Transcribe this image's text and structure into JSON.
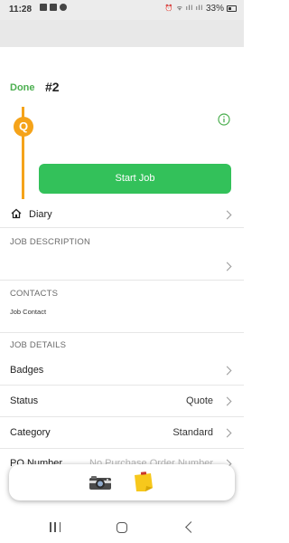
{
  "status_bar": {
    "time": "11:28",
    "battery": "33%"
  },
  "header": {
    "done_label": "Done",
    "title": "#2"
  },
  "job_status": {
    "badge_letter": "Q",
    "accent_color": "#f5a31a"
  },
  "start_job_label": "Start Job",
  "diary": {
    "label": "Diary",
    "icon": "home-icon"
  },
  "job_description": {
    "header": "JOB DESCRIPTION"
  },
  "contacts": {
    "header": "CONTACTS",
    "item": "Job Contact"
  },
  "job_details": {
    "header": "JOB DETAILS",
    "rows": [
      {
        "label": "Badges",
        "value": ""
      },
      {
        "label": "Status",
        "value": "Quote"
      },
      {
        "label": "Category",
        "value": "Standard"
      },
      {
        "label": "PO Number",
        "value": "No Purchase Order Number"
      }
    ]
  },
  "toolbar": {
    "camera_icon": "camera-icon",
    "note_icon": "sticky-note-icon"
  },
  "colors": {
    "done": "#4caf50",
    "start_job": "#33c15a",
    "status_accent": "#f5a31a"
  }
}
